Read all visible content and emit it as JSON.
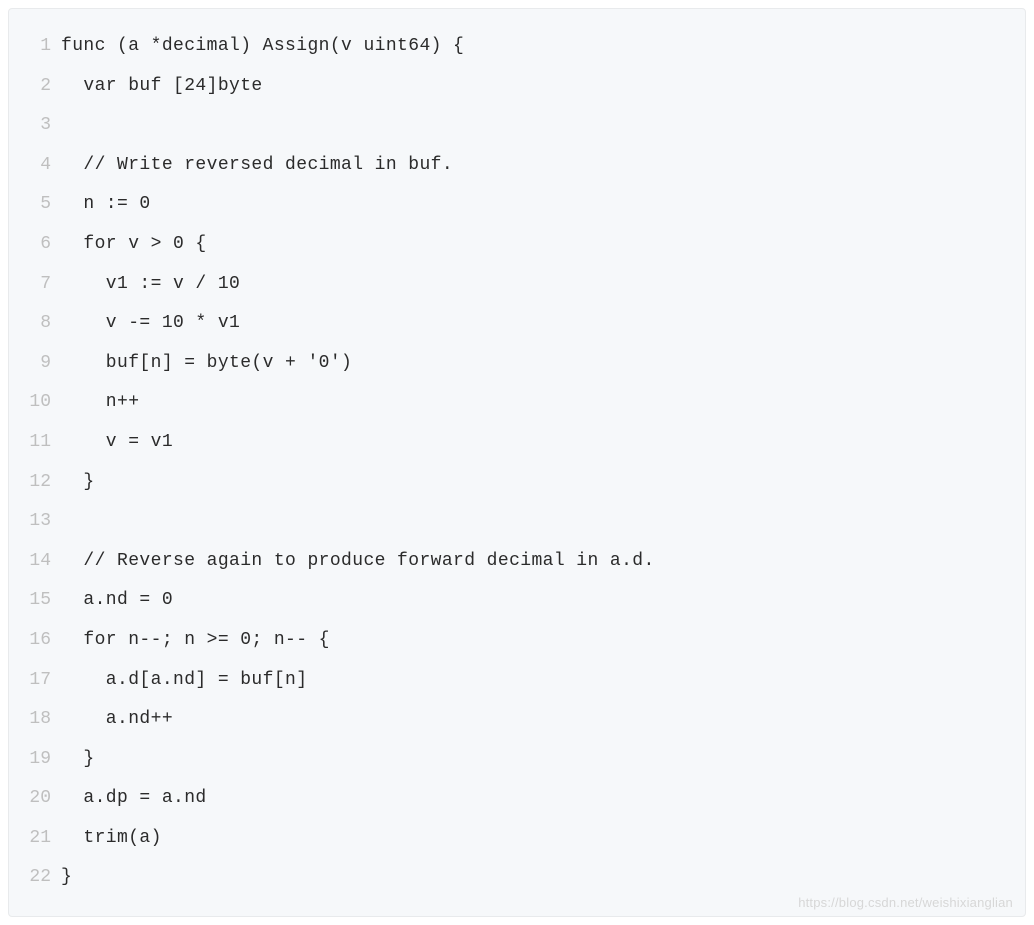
{
  "code": {
    "lines": [
      {
        "n": "1",
        "t": "func (a *decimal) Assign(v uint64) {"
      },
      {
        "n": "2",
        "t": "  var buf [24]byte"
      },
      {
        "n": "3",
        "t": ""
      },
      {
        "n": "4",
        "t": "  // Write reversed decimal in buf."
      },
      {
        "n": "5",
        "t": "  n := 0"
      },
      {
        "n": "6",
        "t": "  for v > 0 {"
      },
      {
        "n": "7",
        "t": "    v1 := v / 10"
      },
      {
        "n": "8",
        "t": "    v -= 10 * v1"
      },
      {
        "n": "9",
        "t": "    buf[n] = byte(v + '0')"
      },
      {
        "n": "10",
        "t": "    n++"
      },
      {
        "n": "11",
        "t": "    v = v1"
      },
      {
        "n": "12",
        "t": "  }"
      },
      {
        "n": "13",
        "t": ""
      },
      {
        "n": "14",
        "t": "  // Reverse again to produce forward decimal in a.d."
      },
      {
        "n": "15",
        "t": "  a.nd = 0"
      },
      {
        "n": "16",
        "t": "  for n--; n >= 0; n-- {"
      },
      {
        "n": "17",
        "t": "    a.d[a.nd] = buf[n]"
      },
      {
        "n": "18",
        "t": "    a.nd++"
      },
      {
        "n": "19",
        "t": "  }"
      },
      {
        "n": "20",
        "t": "  a.dp = a.nd"
      },
      {
        "n": "21",
        "t": "  trim(a)"
      },
      {
        "n": "22",
        "t": "}"
      }
    ]
  },
  "watermark": "https://blog.csdn.net/weishixianglian"
}
